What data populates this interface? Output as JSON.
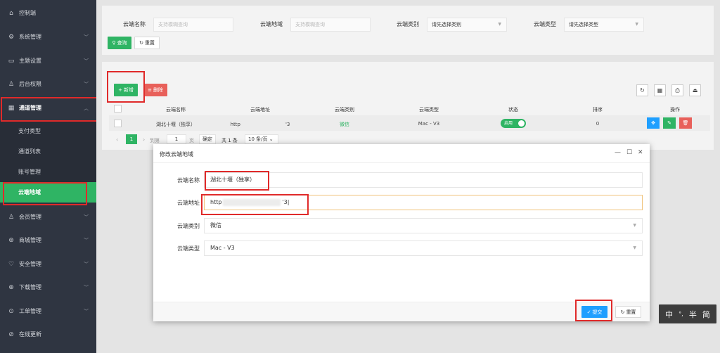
{
  "sidebar": {
    "items": [
      {
        "icon": "⌂",
        "label": "控制端"
      },
      {
        "icon": "⚙",
        "label": "系统管理"
      },
      {
        "icon": "▭",
        "label": "主题设置"
      },
      {
        "icon": "♙",
        "label": "后台权限"
      },
      {
        "icon": "▦",
        "label": "通道管理"
      },
      {
        "icon": "♙",
        "label": "会员管理"
      },
      {
        "icon": "⊛",
        "label": "商城管理"
      },
      {
        "icon": "♡",
        "label": "安全管理"
      },
      {
        "icon": "⊕",
        "label": "下载管理"
      },
      {
        "icon": "⊙",
        "label": "工单管理"
      },
      {
        "icon": "⊘",
        "label": "在线更新"
      }
    ],
    "submenu": [
      "支付类型",
      "通道列表",
      "账号管理",
      "云端地域"
    ]
  },
  "search": {
    "name_label": "云端名称",
    "name_placeholder": "支持模糊查询",
    "addr_label": "云端地域",
    "addr_placeholder": "支持模糊查询",
    "category_label": "云端类别",
    "category_value": "请先选择类别",
    "type_label": "云端类型",
    "type_value": "请先选择类型",
    "query_label": "查询",
    "reset_label": "重置"
  },
  "toolbar": {
    "add_label": "新增",
    "delete_label": "删除"
  },
  "table": {
    "headers": [
      "云端名称",
      "云端地址",
      "云端类别",
      "云端类型",
      "状态",
      "排序",
      "操作"
    ],
    "row": {
      "name": "湖北十堰（独享）",
      "addr_prefix": "http",
      "addr_suffix": "'3",
      "category": "微信",
      "type": "Mac - V3",
      "status": "启用",
      "sort": "0"
    }
  },
  "pagination": {
    "current_page": "1",
    "goto_label": "到第",
    "goto_value": "1",
    "page_unit": "页",
    "confirm_label": "确定",
    "total_label": "共 1 条",
    "page_size": "10 条/页"
  },
  "modal": {
    "title": "修改云端地域",
    "name_label": "云端名称",
    "name_value": "湖北十堰（独享）",
    "addr_label": "云端地址",
    "addr_prefix": "http",
    "addr_suffix": "'3",
    "category_label": "云端类别",
    "category_value": "微信",
    "type_label": "云端类型",
    "type_value": "Mac - V3",
    "submit_label": "提交",
    "reset_label": "重置"
  },
  "ime": {
    "mode": "中",
    "punct": "°,",
    "width": "半",
    "script": "简"
  },
  "colors": {
    "sidebar_bg": "#2f3541",
    "accent_green": "#2fb464",
    "danger_red": "#e8605a",
    "info_blue": "#1e9fff",
    "highlight_red": "#e02a2a"
  }
}
